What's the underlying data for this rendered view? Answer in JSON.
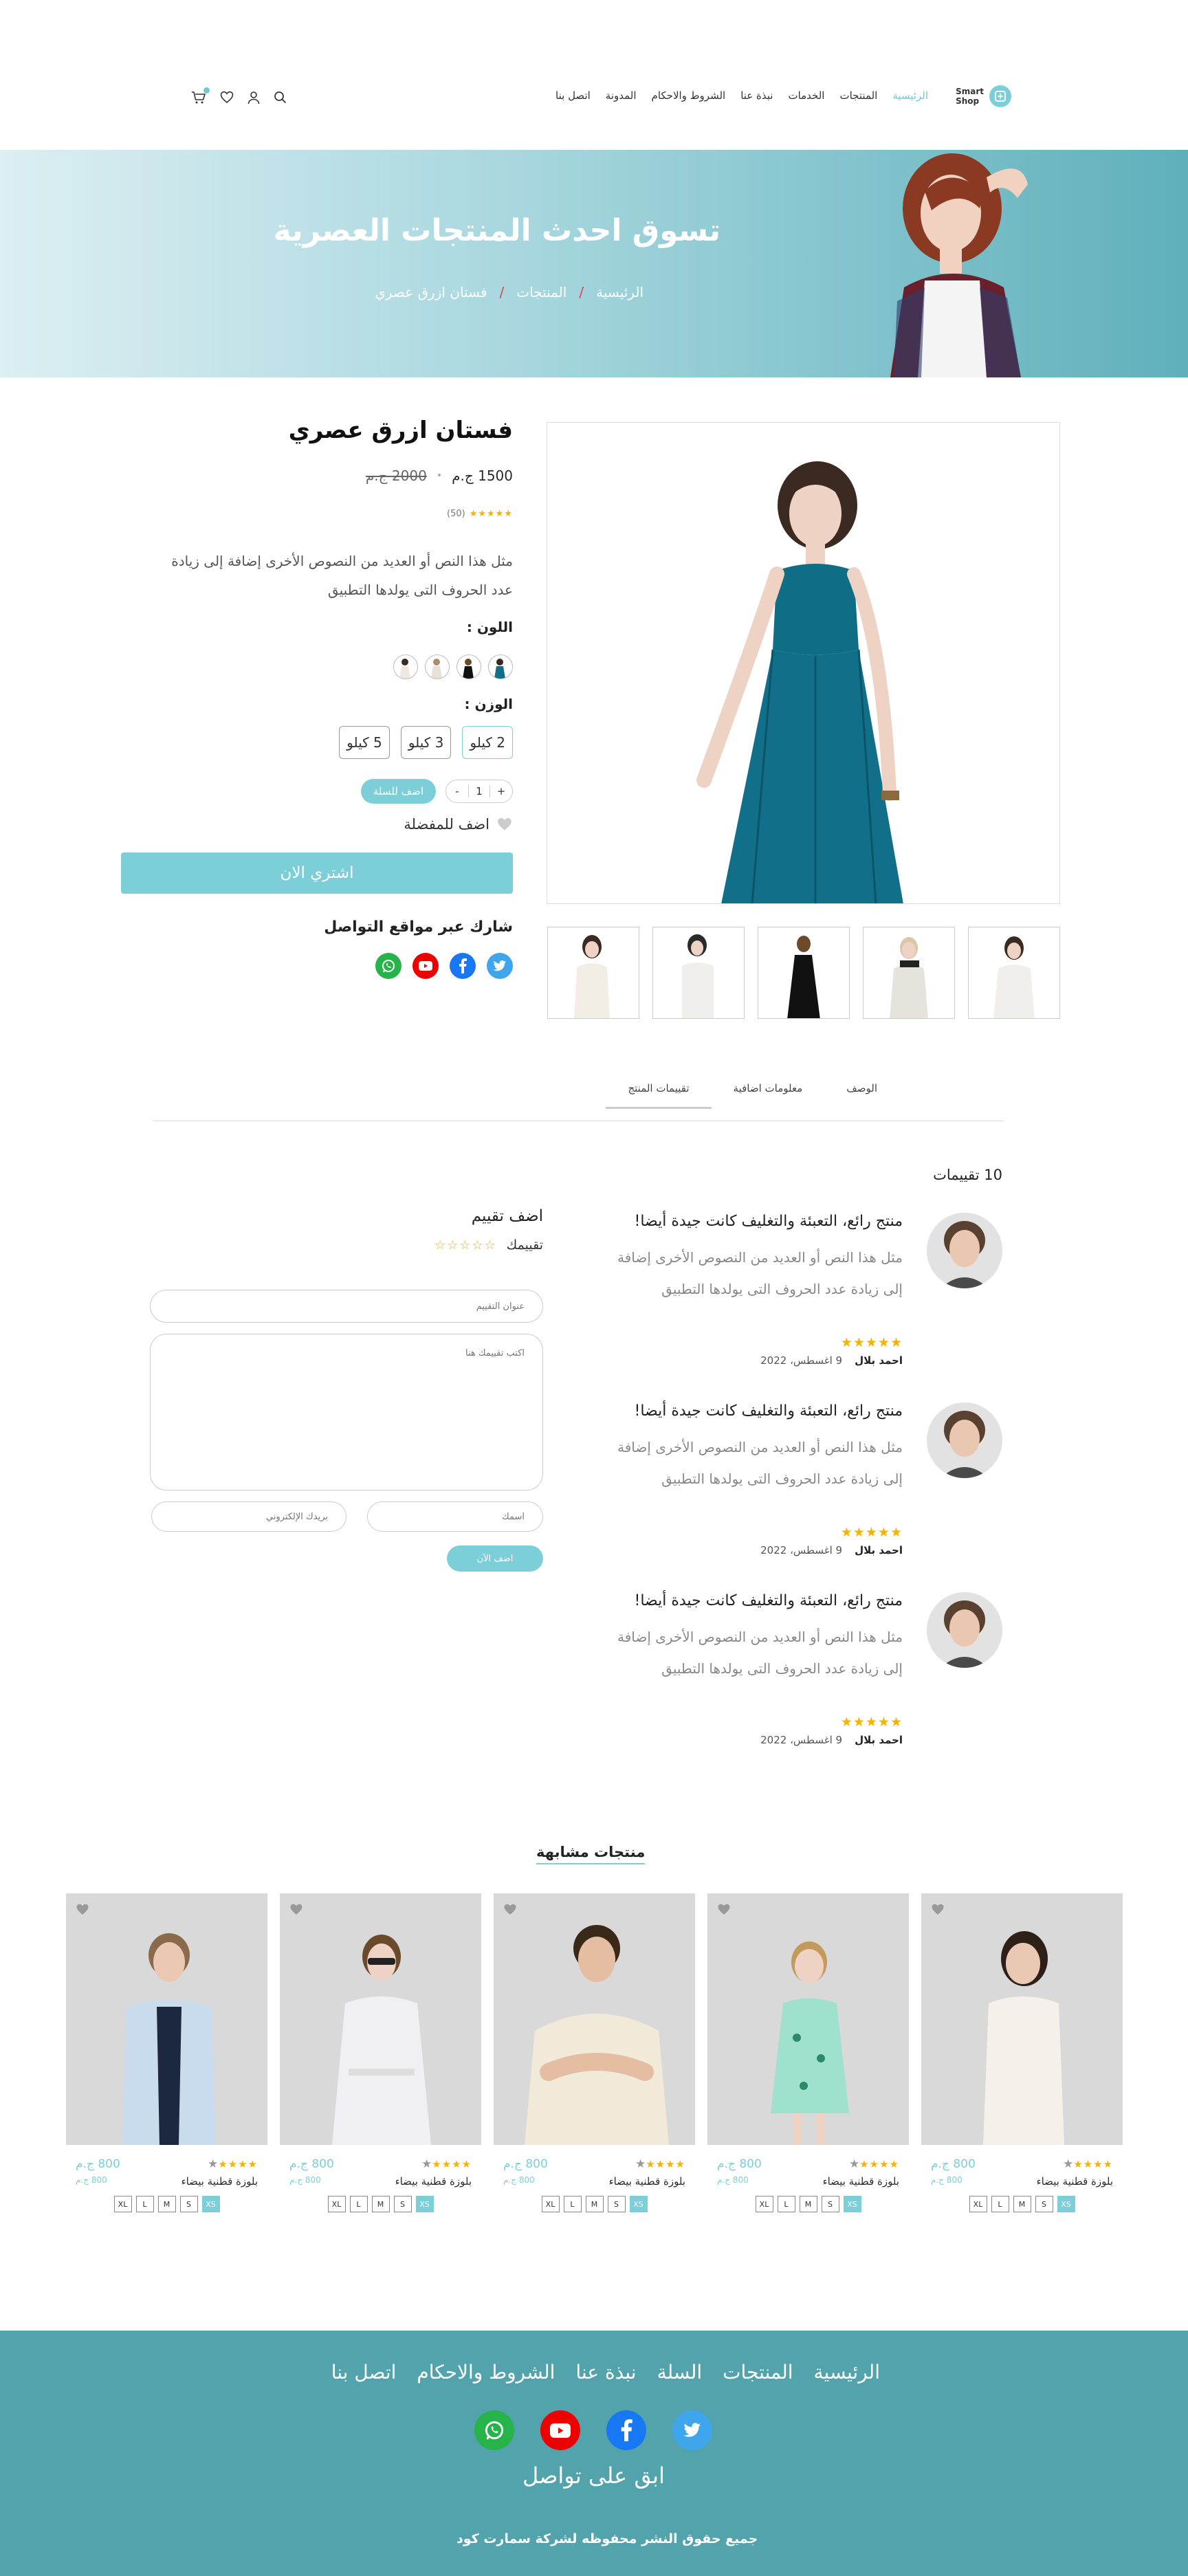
{
  "header": {
    "logo_line1": "Smart",
    "logo_line2": "Shop",
    "nav": [
      "الرئيسية",
      "المنتجات",
      "الخدمات",
      "نبذة عنا",
      "الشروط والاحكام",
      "المدونة",
      "اتصل بنا"
    ],
    "icons": [
      "search-icon",
      "user-icon",
      "heart-icon",
      "cart-icon"
    ]
  },
  "hero": {
    "title": "تسوق احدث المنتجات العصرية",
    "breadcrumb": [
      "الرئيسية",
      "المنتجات",
      "فستان ازرق عصري"
    ]
  },
  "product": {
    "title": "فستان ازرق عصري",
    "price": "1500 ج.م",
    "old_price": "2000 ج.م",
    "rating_stars": "★★★★★",
    "rating_count": "(50)",
    "description": "مثل هذا النص أو العديد من النصوص الأخرى إضافة إلى زيادة عدد الحروف التى يولدها التطبيق",
    "color_label": "اللون :",
    "weight_label": "الوزن :",
    "weights": [
      "2 كيلو",
      "3 كيلو",
      "5 كيلو"
    ],
    "qty_plus": "+",
    "qty_value": "1",
    "qty_minus": "-",
    "add_to_cart": "اضف للسلة",
    "add_favorite": "اضف للمفضلة",
    "buy_now": "اشتري الان",
    "share_title": "شارك عبر مواقع التواصل"
  },
  "tabs": [
    "الوصف",
    "معلومات اضافية",
    "تقييمات المنتج"
  ],
  "reviews": {
    "count_label": "10 تقييمات",
    "items": [
      {
        "title": "منتج رائع، التعبئة والتغليف كانت جيدة أيضا!",
        "text": "مثل هذا النص أو العديد من النصوص الأخرى إضافة إلى زيادة عدد الحروف التى يولدها التطبيق",
        "stars": "★★★★★",
        "author": "احمد بلال",
        "date": "9 اغسطس، 2022"
      },
      {
        "title": "منتج رائع، التعبئة والتغليف كانت جيدة أيضا!",
        "text": "مثل هذا النص أو العديد من النصوص الأخرى إضافة إلى زيادة عدد الحروف التى يولدها التطبيق",
        "stars": "★★★★★",
        "author": "احمد بلال",
        "date": "9 اغسطس، 2022"
      },
      {
        "title": "منتج رائع، التعبئة والتغليف كانت جيدة أيضا!",
        "text": "مثل هذا النص أو العديد من النصوص الأخرى إضافة إلى زيادة عدد الحروف التى يولدها التطبيق",
        "stars": "★★★★★",
        "author": "احمد بلال",
        "date": "9 اغسطس، 2022"
      }
    ]
  },
  "add_review": {
    "title": "اضف تقييم",
    "rating_label": "تقييمك",
    "rating_stars": "☆☆☆☆☆",
    "title_placeholder": "عنوان التقييم",
    "body_placeholder": "اكتب تقييمك هنا",
    "name_placeholder": "اسمك",
    "email_placeholder": "بريدك الإلكتروني",
    "submit": "اضف الآن"
  },
  "similar": {
    "title": "منتجات مشابهة",
    "products": [
      {
        "name": "بلوزة قطنية بيضاء",
        "price": "800 ج.م",
        "old": "800 ج.م",
        "stars": "★★★★",
        "star_off": "★",
        "sizes": [
          "XS",
          "S",
          "M",
          "L",
          "XL"
        ]
      },
      {
        "name": "بلوزة قطنية بيضاء",
        "price": "800 ج.م",
        "old": "800 ج.م",
        "stars": "★★★★",
        "star_off": "★",
        "sizes": [
          "XS",
          "S",
          "M",
          "L",
          "XL"
        ]
      },
      {
        "name": "بلوزة قطنية بيضاء",
        "price": "800 ج.م",
        "old": "800 ج.م",
        "stars": "★★★★",
        "star_off": "★",
        "sizes": [
          "XS",
          "S",
          "M",
          "L",
          "XL"
        ]
      },
      {
        "name": "بلوزة قطنية بيضاء",
        "price": "800 ج.م",
        "old": "800 ج.م",
        "stars": "★★★★",
        "star_off": "★",
        "sizes": [
          "XS",
          "S",
          "M",
          "L",
          "XL"
        ]
      },
      {
        "name": "بلوزة قطنية بيضاء",
        "price": "800 ج.م",
        "old": "800 ج.م",
        "stars": "★★★★",
        "star_off": "★",
        "sizes": [
          "XS",
          "S",
          "M",
          "L",
          "XL"
        ]
      }
    ]
  },
  "footer": {
    "nav": [
      "الرئيسية",
      "المنتجات",
      "السلة",
      "نبذة عنا",
      "الشروط والاحكام",
      "اتصل بنا"
    ],
    "tagline": "ابق على تواصل",
    "copyright": "جميع حقوق النشر محفوظه لشركة سمارت كود"
  },
  "colors": {
    "accent": "#7ccfd9",
    "footer": "#52a3ac",
    "star": "#f5b301"
  }
}
